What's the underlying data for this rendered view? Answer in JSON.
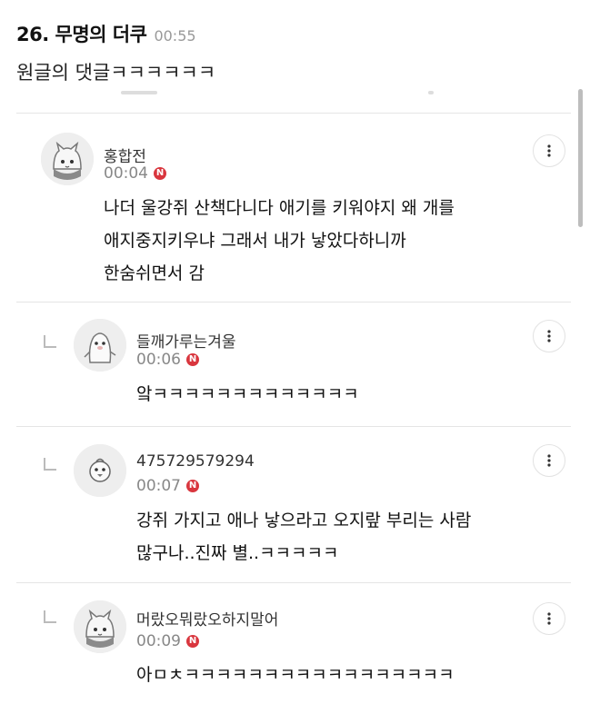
{
  "post": {
    "title": "26. 무명의 더쿠",
    "time": "00:55",
    "body": "원글의 댓글ㅋㅋㅋㅋㅋㅋ"
  },
  "comments": [
    {
      "author": "홍합전",
      "time": "00:04",
      "badge": "N",
      "text": "나더 울강쥐 산책다니다 애기를 키워야지 왜 개를\n애지중지키우냐 그래서 내가 낳았다하니까\n한숨쉬면서 감",
      "avatar_icon": "cat-face-icon"
    },
    {
      "author": "들깨가루는겨울",
      "time": "00:06",
      "badge": "N",
      "text": "앜ㅋㅋㅋㅋㅋㅋㅋㅋㅋㅋㅋㅋㅋ",
      "avatar_icon": "penguin-icon"
    },
    {
      "author": "475729579294",
      "time": "00:07",
      "badge": "N",
      "text": "강쥐 가지고 애나 낳으라고 오지랖 부리는 사람\n많구나..진짜 별..ㅋㅋㅋㅋㅋ",
      "avatar_icon": "chick-icon"
    },
    {
      "author": "머랐오뭐랐오하지말어",
      "time": "00:09",
      "badge": "N",
      "text": "아ㅁㅊㅋㅋㅋㅋㅋㅋㅋㅋㅋㅋㅋㅋㅋㅋㅋㅋㅋ",
      "avatar_icon": "cat-face-icon"
    }
  ],
  "colors": {
    "badge": "#d9363e",
    "divider": "#e5e5e5",
    "meta_text": "#888888"
  }
}
